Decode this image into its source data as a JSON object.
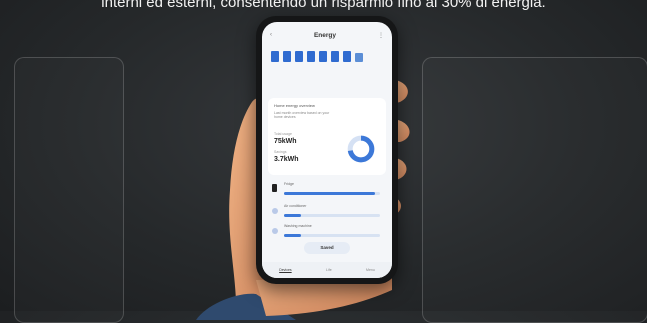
{
  "caption": "interni ed esterni, consentendo un risparmio fino al 30% di energia.",
  "phone": {
    "title": "Energy",
    "week_bar_levels": [
      0.9,
      0.9,
      0.9,
      0.9,
      0.9,
      0.9,
      0.9,
      0.75
    ],
    "card": {
      "heading": "Home energy overview",
      "subtitle": "Last month overview based on your home devices",
      "label_1": "Total usage",
      "value_1": "75kWh",
      "label_2": "Savings",
      "value_2": "3.7kWh",
      "donut_fraction": 0.72
    },
    "rows": [
      {
        "label": "Fridge",
        "fill": 0.95,
        "icon": "fridge-icon"
      },
      {
        "label": "Air conditioner",
        "fill": 0.18,
        "icon": "ac-icon"
      },
      {
        "label": "Washing machine",
        "fill": 0.18,
        "icon": "washer-icon"
      }
    ],
    "button_label": "Saved",
    "nav": [
      "Devices",
      "Life",
      "Menu"
    ]
  },
  "colors": {
    "accent": "#3c78d8",
    "background": "#26292b"
  }
}
